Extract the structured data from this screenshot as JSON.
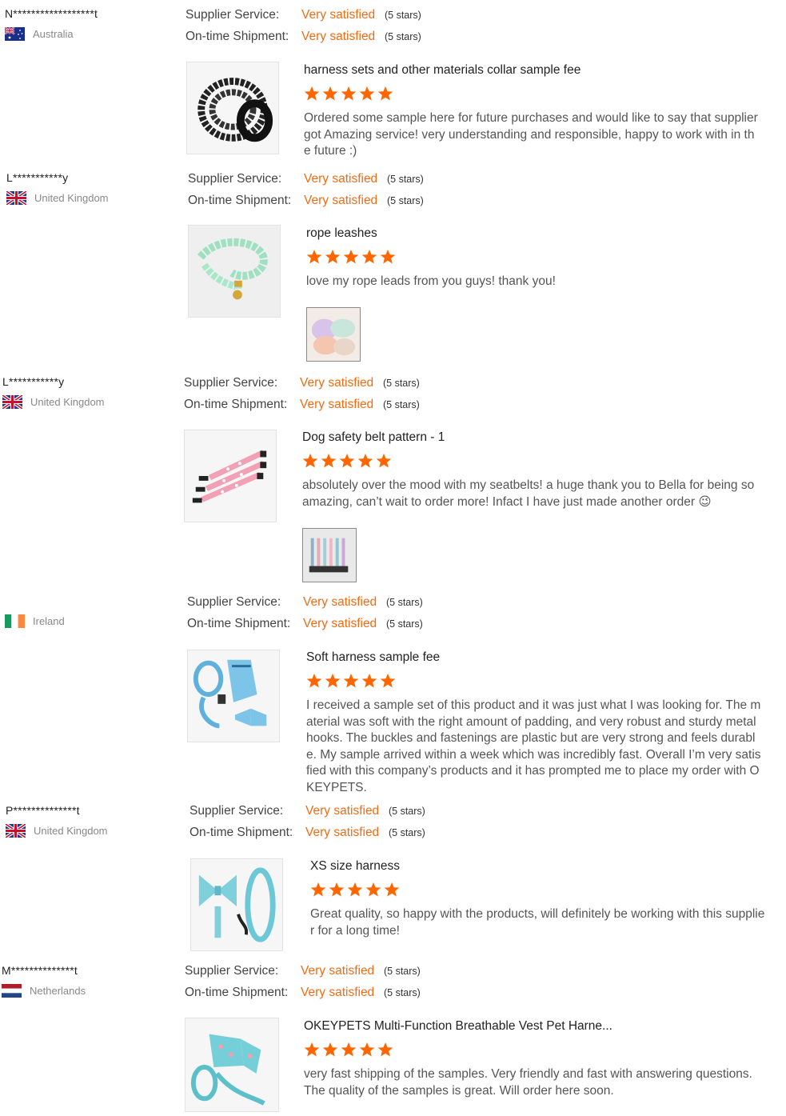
{
  "labels": {
    "supplier_service": "Supplier Service:",
    "ontime_shipment": "On-time Shipment:"
  },
  "colors": {
    "accent": "#f26b13",
    "star": "#ff6600"
  },
  "reviews": [
    {
      "buyer": "N******************t",
      "country": "Australia",
      "flag": "australia-flag-icon",
      "supplier_value": "Very satisfied",
      "supplier_stars": "(5 stars)",
      "shipment_value": "Very satisfied",
      "shipment_stars": "(5 stars)",
      "product": "harness sets and other materials collar sample fee",
      "rating": 5,
      "comment": "Ordered some sample here for future purchases and would like to say that supplier got Amazing service! very understanding and responsible, happy to work with in the future :)"
    },
    {
      "buyer": "L***********y",
      "country": "United Kingdom",
      "flag": "uk-flag-icon",
      "supplier_value": "Very satisfied",
      "supplier_stars": "(5 stars)",
      "shipment_value": "Very satisfied",
      "shipment_stars": "(5 stars)",
      "product": "rope leashes",
      "rating": 5,
      "comment": "love my rope leads from you guys! thank you!"
    },
    {
      "buyer": "L***********y",
      "country": "United Kingdom",
      "flag": "uk-flag-icon",
      "supplier_value": "Very satisfied",
      "supplier_stars": "(5 stars)",
      "shipment_value": "Very satisfied",
      "shipment_stars": "(5 stars)",
      "product": "Dog safety belt pattern - 1",
      "rating": 5,
      "comment": "absolutely over the mood with my seatbelts! a huge thank you to Bella for being so amazing, can’t wait to order more! Infact I have just made another order 😉"
    },
    {
      "buyer": "",
      "country": "Ireland",
      "flag": "ireland-flag-icon",
      "supplier_value": "Very satisfied",
      "supplier_stars": "(5 stars)",
      "shipment_value": "Very satisfied",
      "shipment_stars": "(5 stars)",
      "product": "Soft harness sample fee",
      "rating": 5,
      "comment": "I received a sample set of this product and it was just what I was looking for. The material was soft with the right amount of padding, and very robust and sturdy metal hooks. The buckles and fastenings are plastic but are very strong and feels durable. My sample arrived within a week which was incredibly fast. Overall I’m very satisfied with this company’s products and it has prompted me to place my order with OKEYPETS."
    },
    {
      "buyer": "P**************t",
      "country": "United Kingdom",
      "flag": "uk-flag-icon",
      "supplier_value": "Very satisfied",
      "supplier_stars": "(5 stars)",
      "shipment_value": "Very satisfied",
      "shipment_stars": "(5 stars)",
      "product": "XS size harness",
      "rating": 5,
      "comment": "Great quality, so happy with the products, will definitely be working with this supplier for a long time!"
    },
    {
      "buyer": "M**************t",
      "country": "Netherlands",
      "flag": "netherlands-flag-icon",
      "supplier_value": "Very satisfied",
      "supplier_stars": "(5 stars)",
      "shipment_value": "Very satisfied",
      "shipment_stars": "(5 stars)",
      "product": "OKEYPETS Multi-Function Breathable Vest Pet Harne...",
      "rating": 5,
      "comment": "very fast shipping of the samples. Very friendly and fast with answering questions. The quality of the samples is great. Will order here soon."
    }
  ]
}
